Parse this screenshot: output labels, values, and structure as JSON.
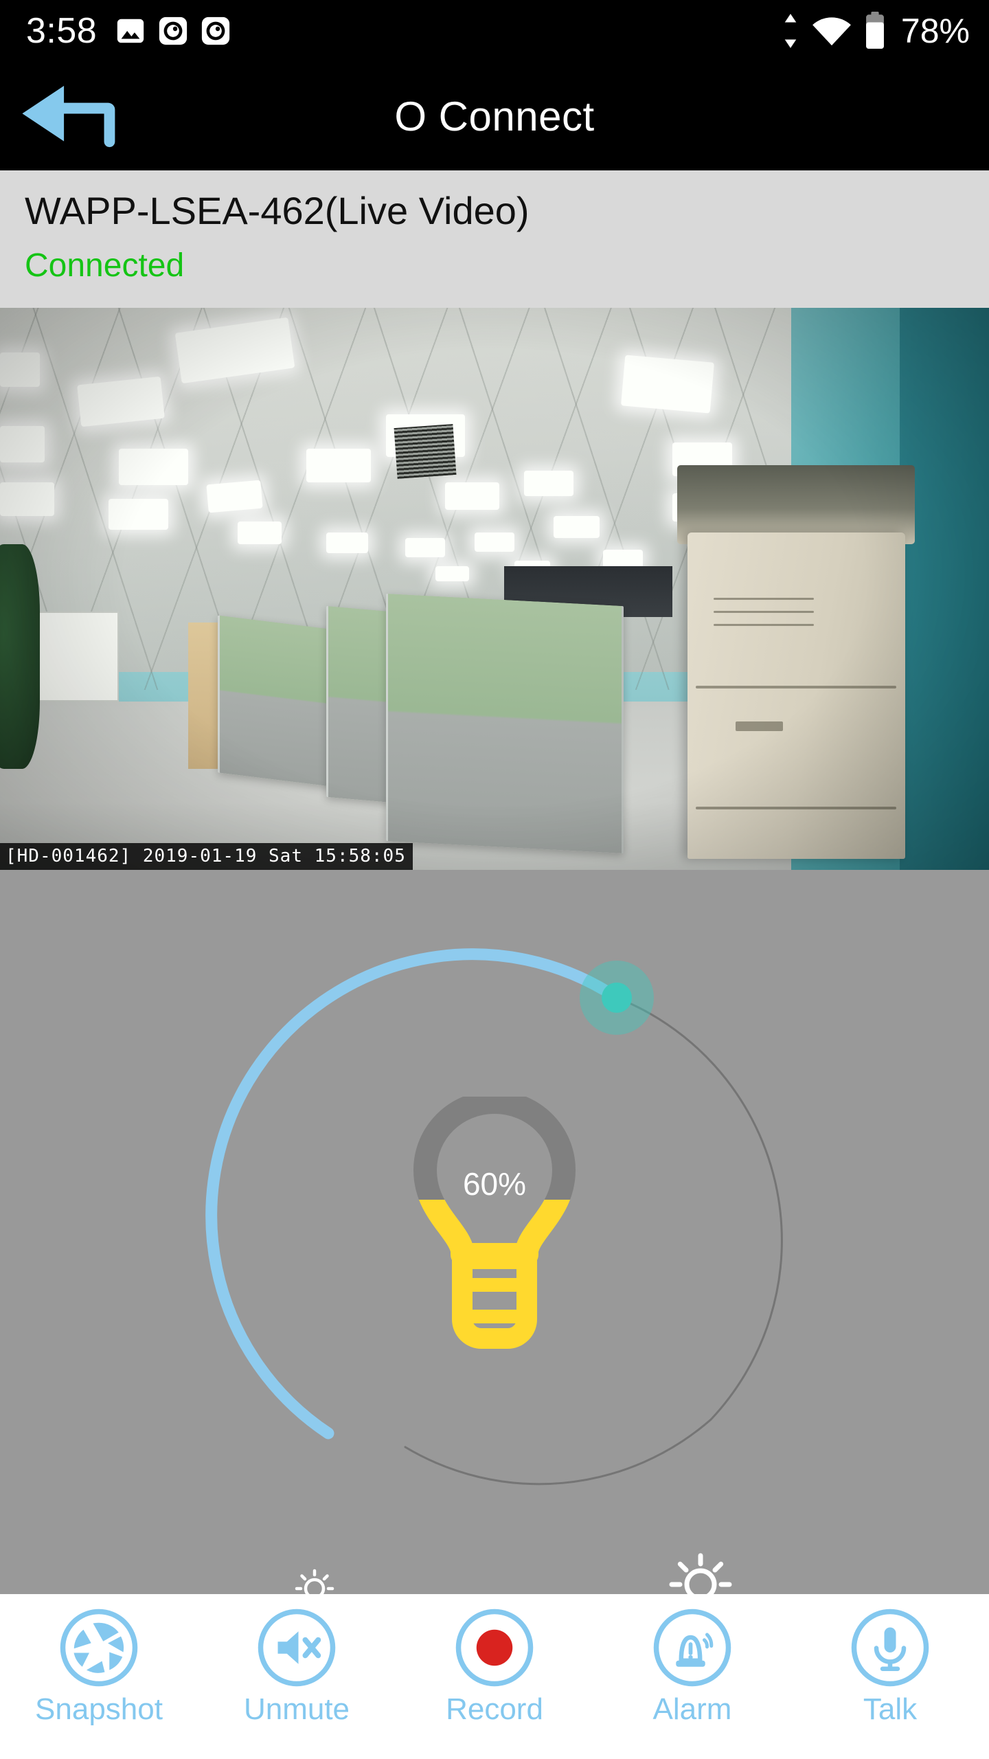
{
  "status_bar": {
    "clock": "3:58",
    "battery_percent": "78%",
    "icons": [
      "photo-icon",
      "eye-app-icon",
      "eye-app-icon",
      "data-transfer-icon",
      "wifi-icon",
      "battery-icon"
    ]
  },
  "title_bar": {
    "back_icon": "back-arrow-icon",
    "title": "O Connect"
  },
  "device_info": {
    "name": "WAPP-LSEA-462(Live Video)",
    "status": "Connected",
    "status_color": "#15c415"
  },
  "video": {
    "timestamp_overlay": "[HD-001462] 2019-01-19 Sat 15:58:05",
    "scene": "office-ceiling-cubicles-live-view"
  },
  "brightness_control": {
    "value_label": "60%",
    "value": 60,
    "min": 0,
    "max": 100,
    "arc_color": "#8ecbee",
    "track_color": "#6e6e6e",
    "thumb_color": "#3ec9bc",
    "bulb_fill_color": "#ffd92e",
    "bulb_empty_color": "#808080",
    "low_icon": "sun-small-icon",
    "high_icon": "sun-large-icon",
    "panel_color": "#999999"
  },
  "toolbar": {
    "accent_color": "#84c8ef",
    "record_color": "#d9231f",
    "buttons": [
      {
        "label": "Snapshot",
        "icon": "camera-aperture-icon"
      },
      {
        "label": "Unmute",
        "icon": "speaker-mute-icon"
      },
      {
        "label": "Record",
        "icon": "record-dot-icon"
      },
      {
        "label": "Alarm",
        "icon": "siren-icon"
      },
      {
        "label": "Talk",
        "icon": "microphone-icon"
      }
    ]
  }
}
